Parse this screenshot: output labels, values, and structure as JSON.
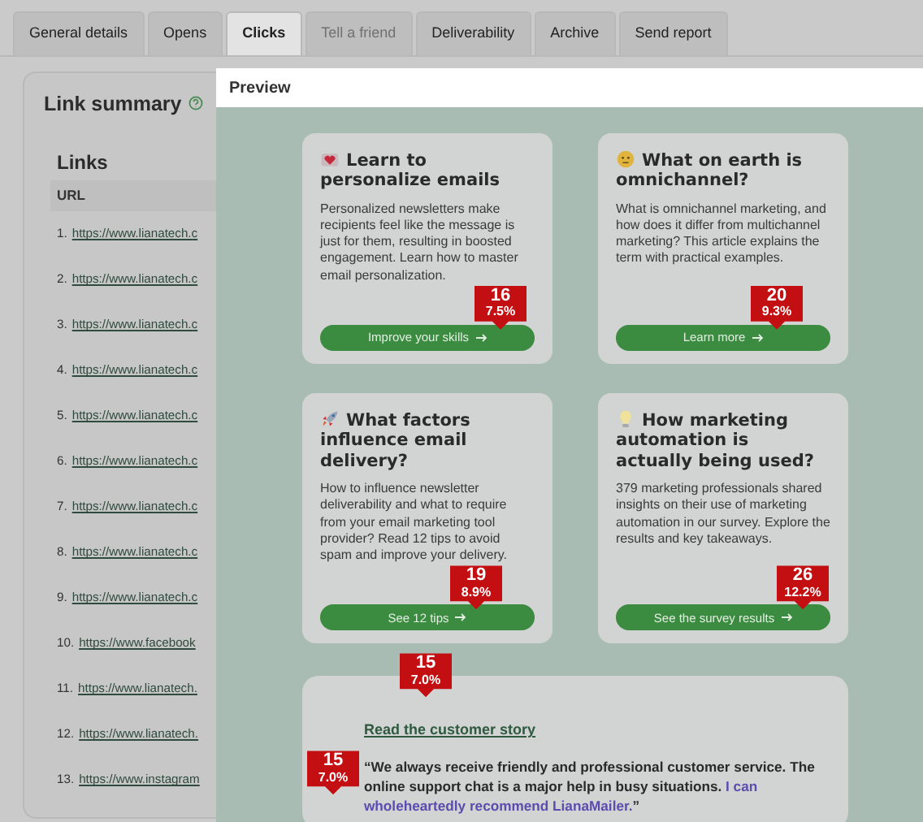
{
  "tabs": [
    {
      "label": "General details",
      "selected": false,
      "disabled": false
    },
    {
      "label": "Opens",
      "selected": false,
      "disabled": false
    },
    {
      "label": "Clicks",
      "selected": true,
      "disabled": false
    },
    {
      "label": "Tell a friend",
      "selected": false,
      "disabled": true
    },
    {
      "label": "Deliverability",
      "selected": false,
      "disabled": false
    },
    {
      "label": "Archive",
      "selected": false,
      "disabled": false
    },
    {
      "label": "Send report",
      "selected": false,
      "disabled": false
    }
  ],
  "link_summary": {
    "title": "Link summary",
    "box_title": "Links",
    "column": "URL",
    "rows": [
      {
        "number": "1.",
        "url": "https://www.lianatech.c"
      },
      {
        "number": "2.",
        "url": "https://www.lianatech.c"
      },
      {
        "number": "3.",
        "url": "https://www.lianatech.c"
      },
      {
        "number": "4.",
        "url": "https://www.lianatech.c"
      },
      {
        "number": "5.",
        "url": "https://www.lianatech.c"
      },
      {
        "number": "6.",
        "url": "https://www.lianatech.c"
      },
      {
        "number": "7.",
        "url": "https://www.lianatech.c"
      },
      {
        "number": "8.",
        "url": "https://www.lianatech.c"
      },
      {
        "number": "9.",
        "url": "https://www.lianatech.c"
      },
      {
        "number": "10.",
        "url": "https://www.facebook"
      },
      {
        "number": "11.",
        "url": "https://www.lianatech."
      },
      {
        "number": "12.",
        "url": "https://www.lianatech."
      },
      {
        "number": "13.",
        "url": "https://www.instagram"
      }
    ]
  },
  "preview": {
    "title": "Preview",
    "cards": [
      {
        "kind": "heart",
        "title": "Learn to personalize emails",
        "text": "Personalized newsletters make recipients feel like the message is just for them, resulting in boosted engagement. Learn how to master email personalization.",
        "button": "Improve your skills",
        "clicks": "16",
        "rate": "7.5%"
      },
      {
        "kind": "thinking",
        "title": "What on earth is omnichannel?",
        "text": "What is omnichannel marketing, and how does it differ from multichannel marketing? This article explains the term with practical examples.",
        "button": "Learn more",
        "clicks": "20",
        "rate": "9.3%"
      },
      {
        "kind": "rocket",
        "title": "What factors influence email delivery?",
        "text": "How to influence newsletter deliverability and what to require from your email marketing tool provider? Read 12 tips to avoid spam and improve your delivery.",
        "button": "See 12 tips",
        "clicks": "19",
        "rate": "8.9%"
      },
      {
        "kind": "bulb",
        "title": "How marketing automation is actually being used?",
        "text": "379 marketing professionals shared insights on their use of marketing automation in our survey. Explore the results and key takeaways.",
        "button": "See the survey results",
        "clicks": "26",
        "rate": "12.2%"
      }
    ],
    "story": {
      "link": "Read the customer story",
      "link_clicks": "15",
      "link_rate": "7.0%",
      "quote": [
        {
          "text": "“We always receive friendly and professional customer service. The online support chat is a major help in busy situations. ",
          "highlight": false
        },
        {
          "text": "I can wholeheartedly recommend LianaMailer.",
          "highlight": true
        },
        {
          "text": "”",
          "highlight": false
        }
      ],
      "quote_clicks": "15",
      "quote_rate": "7.0%"
    }
  }
}
